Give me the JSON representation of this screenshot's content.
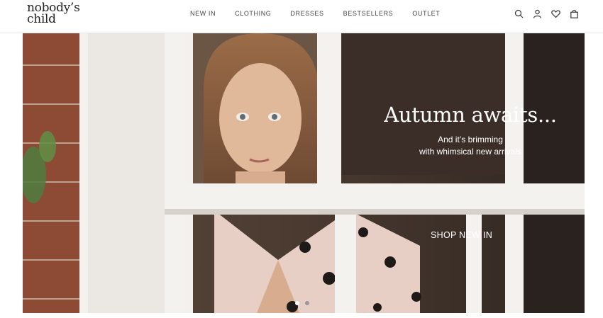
{
  "brand": {
    "line1": "nobody’s",
    "line2": "child"
  },
  "nav": [
    {
      "label": "NEW IN"
    },
    {
      "label": "CLOTHING"
    },
    {
      "label": "DRESSES"
    },
    {
      "label": "BESTSELLERS"
    },
    {
      "label": "OUTLET"
    }
  ],
  "header_icons": [
    "search-icon",
    "account-icon",
    "wishlist-heart-icon",
    "bag-icon"
  ],
  "hero": {
    "title": "Autumn awaits...",
    "subtitle_line1": "And it’s brimming",
    "subtitle_line2": "with whimsical new arrivals",
    "cta": "SHOP NEW IN",
    "slide_count": 2,
    "active_slide": 1
  }
}
